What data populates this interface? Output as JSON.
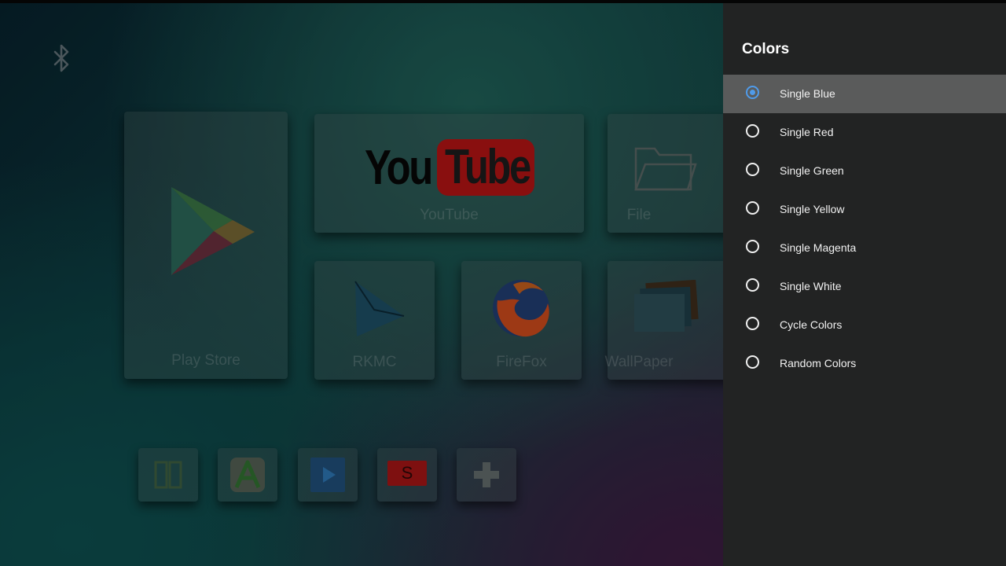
{
  "launcher": {
    "apps": [
      {
        "label": "Play Store"
      },
      {
        "label": "YouTube"
      },
      {
        "label": "File"
      },
      {
        "label": "RKMC"
      },
      {
        "label": "FireFox"
      },
      {
        "label": "WallPaper"
      }
    ],
    "youtube_logo": {
      "you": "You",
      "tube": "Tube"
    },
    "shortcut_s": "S"
  },
  "panel": {
    "title": "Colors",
    "options": [
      {
        "label": "Single Blue",
        "selected": true
      },
      {
        "label": "Single Red",
        "selected": false
      },
      {
        "label": "Single Green",
        "selected": false
      },
      {
        "label": "Single Yellow",
        "selected": false
      },
      {
        "label": "Single Magenta",
        "selected": false
      },
      {
        "label": "Single White",
        "selected": false
      },
      {
        "label": "Cycle Colors",
        "selected": false
      },
      {
        "label": "Random Colors",
        "selected": false
      }
    ]
  },
  "colors": {
    "accent": "#4f9bea",
    "panel_bg": "#222323",
    "selected_row": "#5a5b5b"
  }
}
